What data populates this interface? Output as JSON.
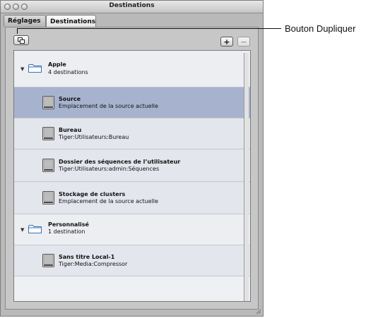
{
  "window": {
    "title": "Destinations",
    "tabs": [
      {
        "label": "Réglages"
      },
      {
        "label": "Destinations"
      }
    ]
  },
  "toolbar": {
    "duplicate_icon": "duplicate-icon",
    "add_label": "+",
    "remove_label": "−"
  },
  "groups": [
    {
      "title": "Apple",
      "subtitle": "4 destinations",
      "icon": "folder-icon",
      "expanded": true
    },
    {
      "title": "Personnalisé",
      "subtitle": "1 destination",
      "icon": "folder-icon",
      "expanded": true
    }
  ],
  "destinations": [
    {
      "title": "Source",
      "subtitle": "Emplacement de la source actuelle",
      "selected": true
    },
    {
      "title": "Bureau",
      "subtitle": "Tiger:Utilisateurs:Bureau",
      "selected": false
    },
    {
      "title": "Dossier des séquences de l’utilisateur",
      "subtitle": "Tiger:Utilisateurs:admin:Séquences",
      "selected": false
    },
    {
      "title": "Stockage de clusters",
      "subtitle": "Emplacement de la source actuelle",
      "selected": false
    },
    {
      "title": "Sans titre  Local-1",
      "subtitle": "Tiger:Media:Compressor",
      "selected": false
    }
  ],
  "callout": {
    "label": "Bouton Dupliquer"
  },
  "colors": {
    "selection": "#a7b3ce",
    "list_background": "#eef0f4"
  }
}
